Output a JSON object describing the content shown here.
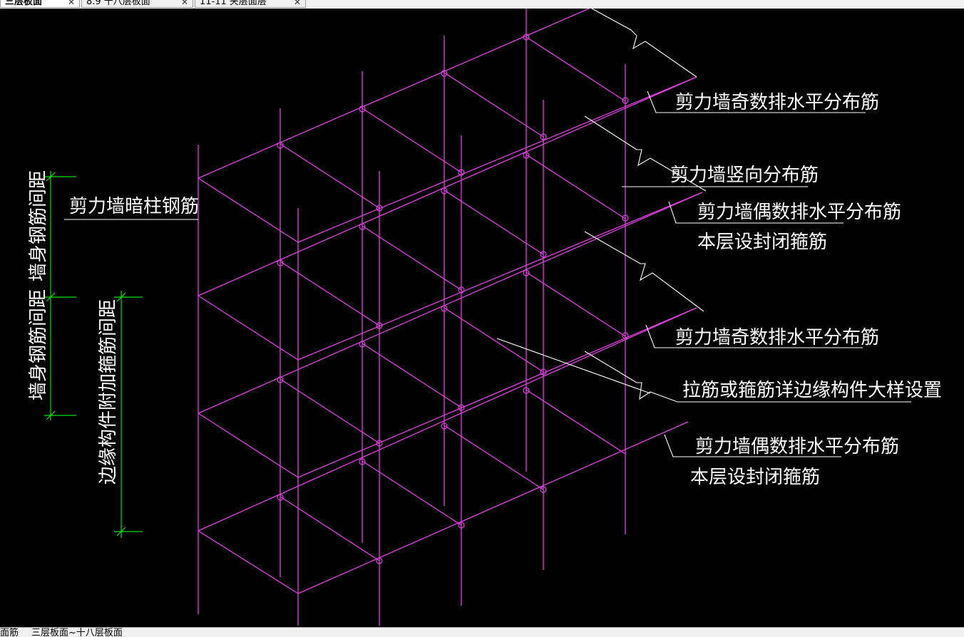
{
  "tabs": [
    {
      "label": "三层板面",
      "active": true
    },
    {
      "label": "8.9 十八层板面",
      "active": false
    },
    {
      "label": "11-11 夹层面层",
      "active": false
    }
  ],
  "labels": {
    "odd_h_top": "剪力墙奇数排水平分布筋",
    "vertical": "剪力墙竖向分布筋",
    "even_h_top": "剪力墙偶数排水平分布筋",
    "closed_top": "本层设封闭箍筋",
    "odd_h_mid": "剪力墙奇数排水平分布筋",
    "tie_note": "拉筋或箍筋详边缘构件大样设置",
    "even_h_bottom": "剪力墙偶数排水平分布筋",
    "closed_bottom": "本层设封闭箍筋",
    "hidden_column": "剪力墙暗柱钢筋",
    "dim_wall_top": "墙身钢筋间距",
    "dim_wall_bottom": "墙身钢筋间距",
    "dim_edge": "边缘构件附加箍筋间距"
  },
  "sheet_tabs": [
    "面筋",
    "三层板面~十八层板面"
  ],
  "colors": {
    "rebar": "#e040e0",
    "leader": "#ffffff",
    "dimension": "#00e000",
    "background": "#000000"
  }
}
